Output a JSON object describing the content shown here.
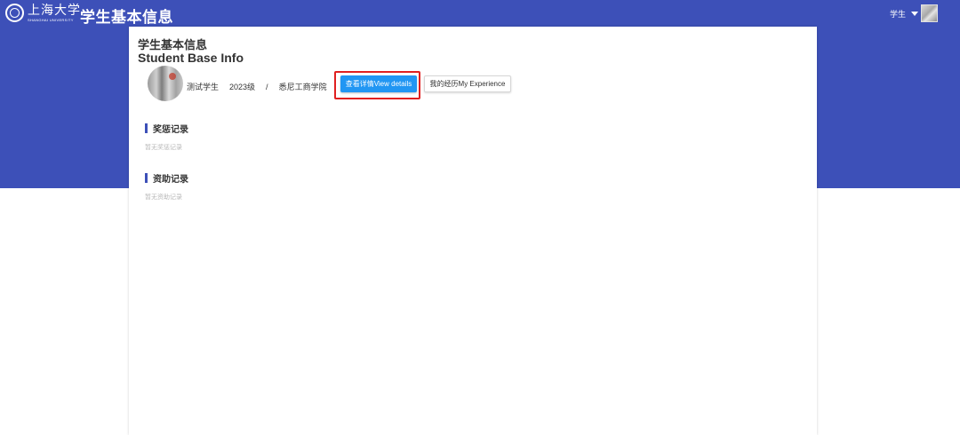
{
  "header": {
    "logo_cn": "上海大学",
    "logo_en": "SHANGHAI UNIVERSITY",
    "app_title": "学生基本信息",
    "role_label": "学生"
  },
  "page": {
    "title": "学生基本信息",
    "subtitle": "Student Base Info"
  },
  "student": {
    "name": "测试学生",
    "grade": "2023级",
    "separator": "/",
    "college": "悉尼工商学院"
  },
  "actions": {
    "view_details_label": "查看详情View details",
    "my_experience_label": "我的经历My Experience"
  },
  "sections": [
    {
      "title": "奖惩记录",
      "empty_text": "暂无奖惩记录"
    },
    {
      "title": "资助记录",
      "empty_text": "暂无资助记录"
    }
  ],
  "colors": {
    "brand_blue": "#3d50b8",
    "primary_button": "#2196f3",
    "highlight_red": "#e02020"
  }
}
